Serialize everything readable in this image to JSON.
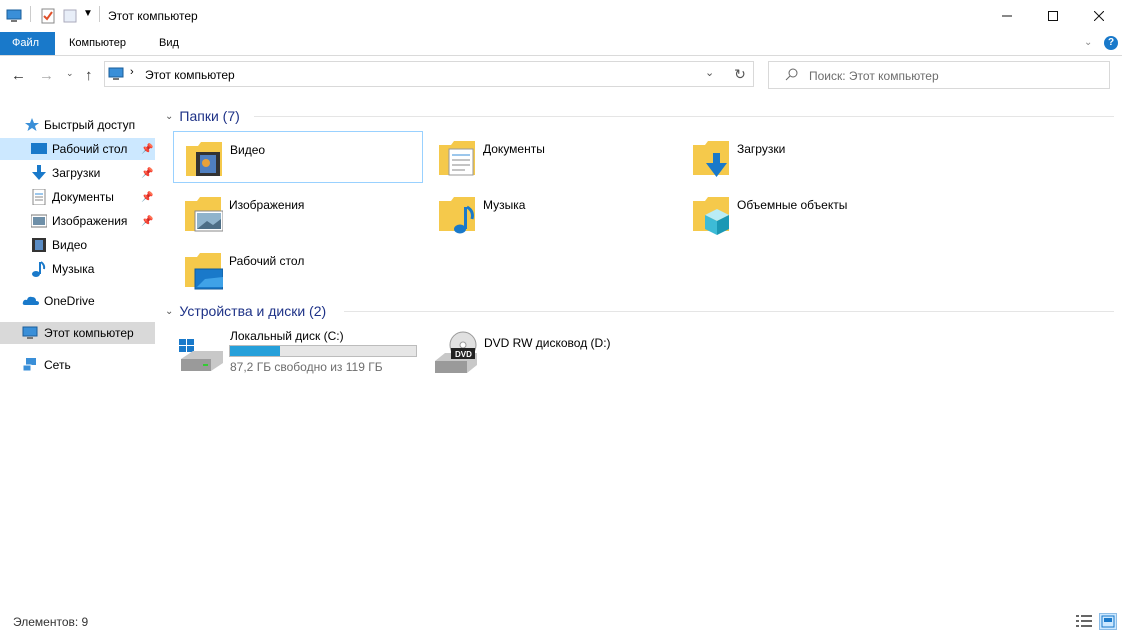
{
  "window": {
    "title": "Этот компьютер"
  },
  "ribbon": {
    "tabs": [
      "Файл",
      "Компьютер",
      "Вид"
    ]
  },
  "address": {
    "path": "Этот компьютер"
  },
  "search": {
    "placeholder": "Поиск: Этот компьютер"
  },
  "nav": {
    "quick_access": "Быстрый доступ",
    "items": [
      "Рабочий стол",
      "Загрузки",
      "Документы",
      "Изображения",
      "Видео",
      "Музыка"
    ],
    "onedrive": "OneDrive",
    "this_pc": "Этот компьютер",
    "network": "Сеть"
  },
  "folders": {
    "header": "Папки (7)",
    "items": [
      "Видео",
      "Документы",
      "Загрузки",
      "Изображения",
      "Музыка",
      "Объемные объекты",
      "Рабочий стол"
    ]
  },
  "devices": {
    "header": "Устройства и диски (2)",
    "items": [
      {
        "name": "Локальный диск (C:)",
        "free_text": "87,2 ГБ свободно из 119 ГБ",
        "used_fraction": 0.27
      },
      {
        "name": "DVD RW дисковод (D:)",
        "badge": "DVD"
      }
    ]
  },
  "status": {
    "items_count": "Элементов: 9"
  },
  "colors": {
    "accent": "#1979ca",
    "selected": "#cce8ff",
    "section_header": "#1e3287",
    "disk_bar": "#26a0da"
  }
}
